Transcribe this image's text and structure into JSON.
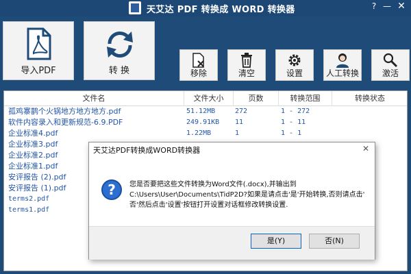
{
  "window": {
    "title": "天艾达 PDF 转换成 WORD 转换器",
    "controls": {
      "help": "?",
      "minimize": "—",
      "close": "✕"
    }
  },
  "toolbar": {
    "import_label": "导入PDF",
    "convert_label": "转 换",
    "remove_label": "移除",
    "clear_label": "清空",
    "settings_label": "设置",
    "manual_label": "人工转换",
    "activate_label": "激活"
  },
  "filelist": {
    "columns": [
      "文件名",
      "文件大小",
      "页数",
      "转换范围",
      "转换状态"
    ],
    "rows": [
      {
        "name": "孤鸡寨鹊个火锅地方地方地方.pdf",
        "size": "51.12MB",
        "pages": "272",
        "range": "1 - 272",
        "status": ""
      },
      {
        "name": "软件内容录入和更新规范-6.9.PDF",
        "size": "249.91KB",
        "pages": "11",
        "range": "1 - 11",
        "status": ""
      },
      {
        "name": "企业标准4.pdf",
        "size": "1.22MB",
        "pages": "1",
        "range": "1 - 1",
        "status": ""
      },
      {
        "name": "企业标准3.pdf",
        "size": "",
        "pages": "",
        "range": "",
        "status": ""
      },
      {
        "name": "企业标准2.pdf",
        "size": "",
        "pages": "",
        "range": "",
        "status": ""
      },
      {
        "name": "企业标准1.pdf",
        "size": "",
        "pages": "",
        "range": "",
        "status": ""
      },
      {
        "name": "安评报告 (2).pdf",
        "size": "",
        "pages": "",
        "range": "",
        "status": ""
      },
      {
        "name": "安评报告 (1).pdf",
        "size": "",
        "pages": "",
        "range": "",
        "status": ""
      },
      {
        "name": "terms2.pdf",
        "size": "",
        "pages": "",
        "range": "",
        "status": ""
      },
      {
        "name": "terms1.pdf",
        "size": "",
        "pages": "",
        "range": "",
        "status": ""
      }
    ]
  },
  "dialog": {
    "title": "天艾达PDF转换成WORD转换器",
    "close": "✕",
    "icon": "question-icon",
    "message_line1": "您是否要把这些文件转换为Word文件(.docx),并输出到",
    "message_line2": "C:\\Users\\User\\Documents\\TidP2D?如果是请点击'是'开始转换,否则请点击'",
    "message_line3": "否'然后点击'设置'按钮打开设置对话框修改转换设置.",
    "yes_label": "是(Y)",
    "no_label": "否(N)"
  },
  "colors": {
    "background": "#1f4b78",
    "accent_blue": "#2d6fd1",
    "row_text": "#2255aa",
    "toolbar_button": "#f3f3f3"
  }
}
